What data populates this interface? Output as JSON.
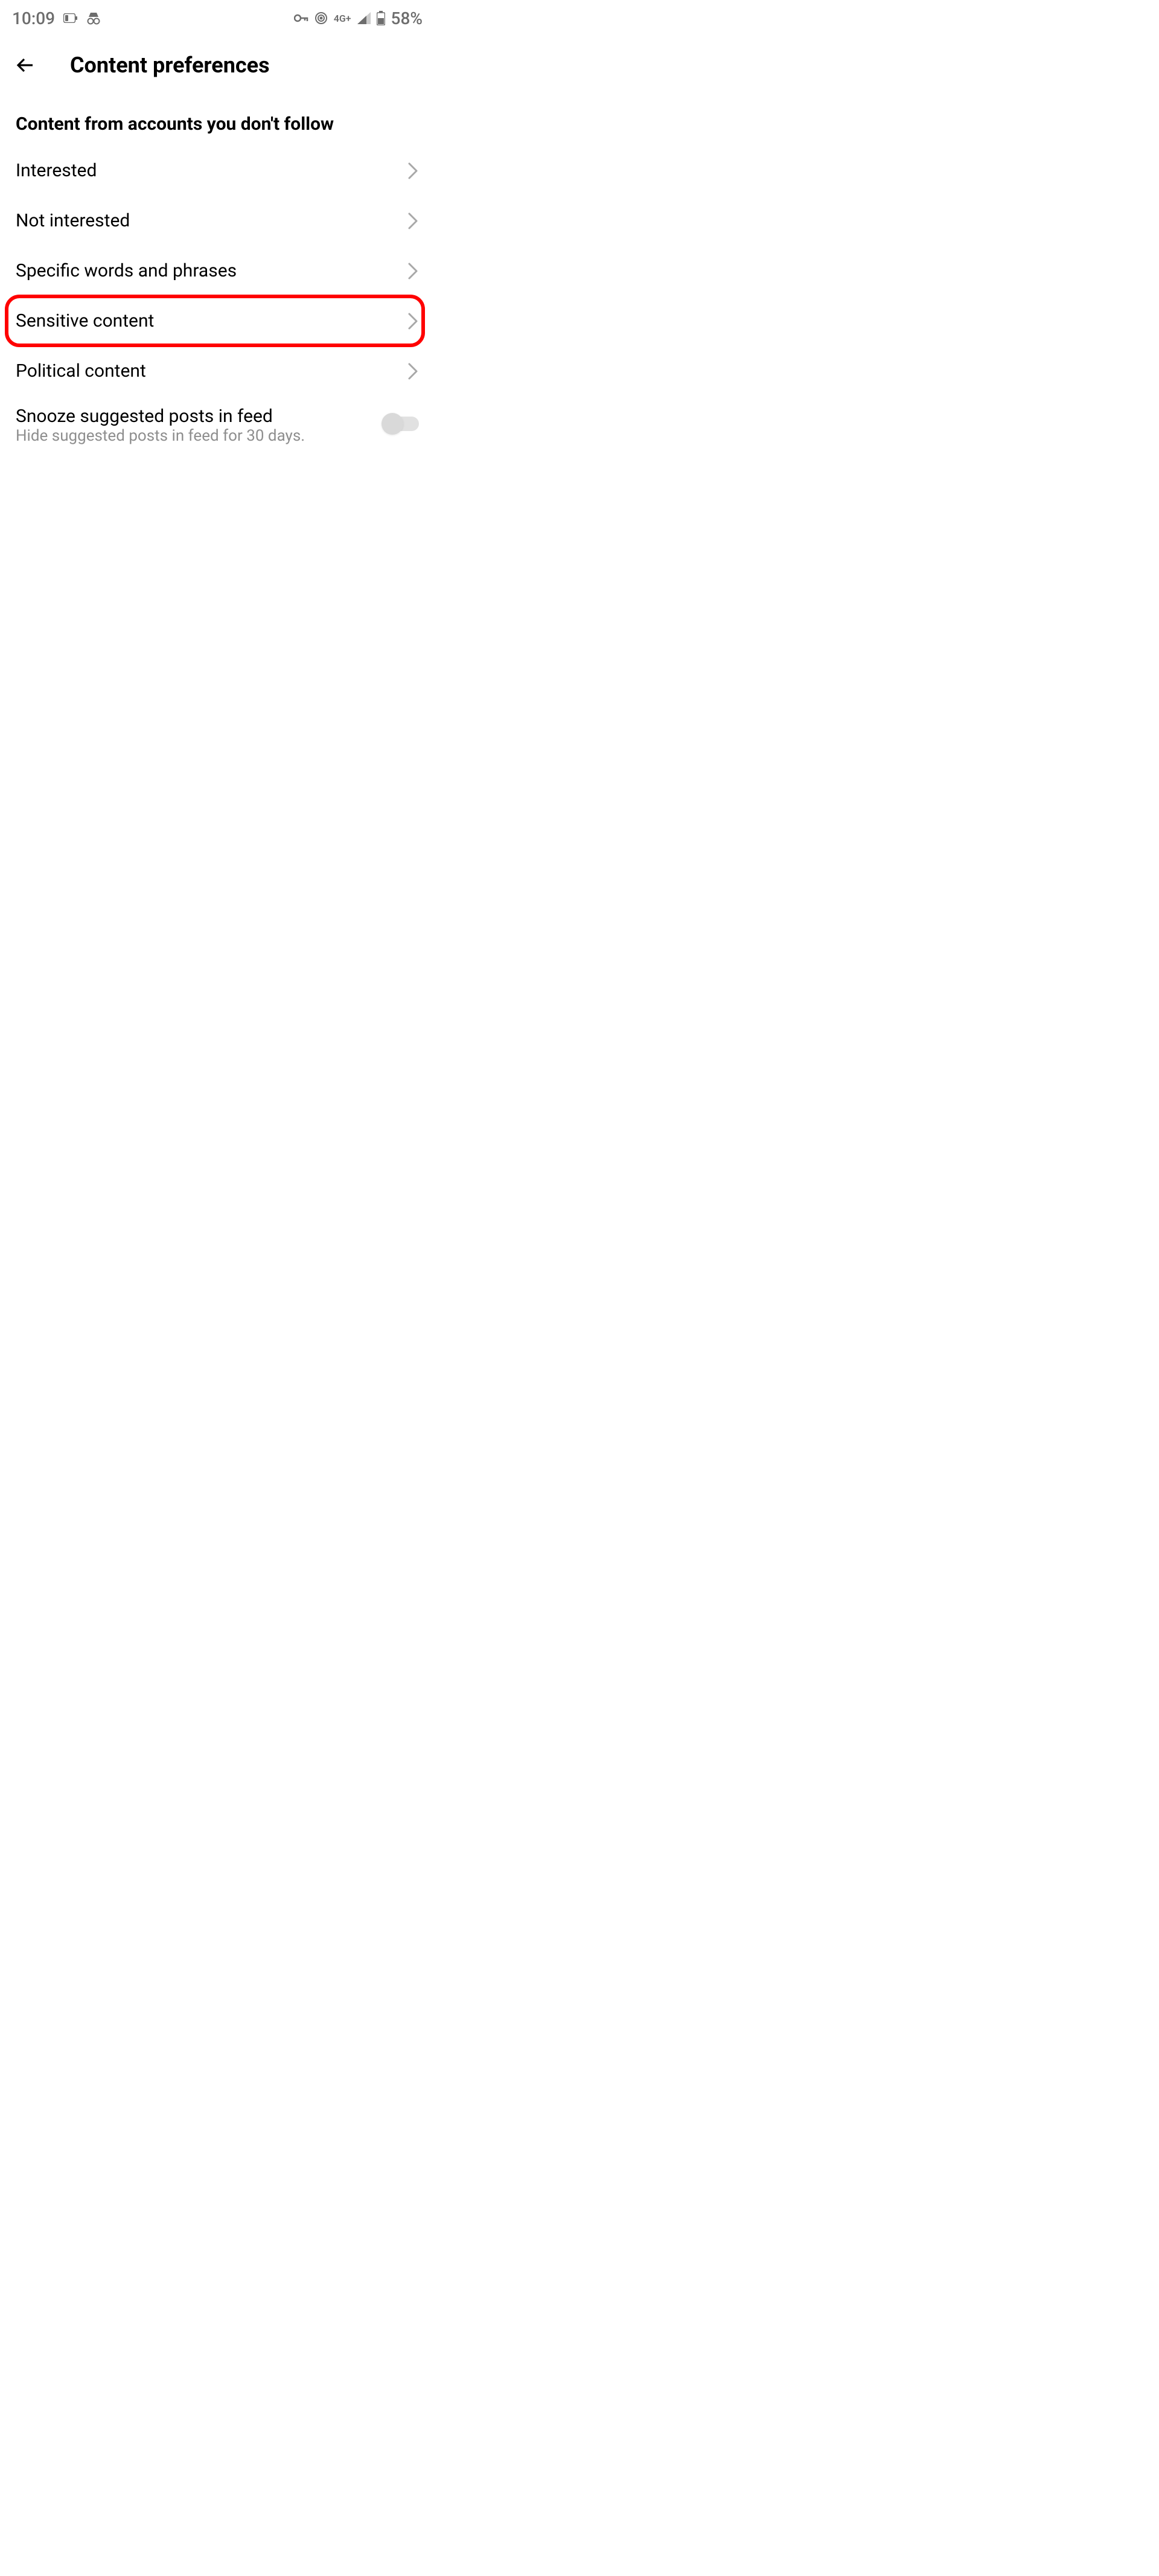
{
  "status_bar": {
    "time": "10:09",
    "network": "4G+",
    "battery": "58%"
  },
  "header": {
    "title": "Content preferences"
  },
  "section": {
    "heading": "Content from accounts you don't follow",
    "items": [
      {
        "label": "Interested",
        "highlighted": false
      },
      {
        "label": "Not interested",
        "highlighted": false
      },
      {
        "label": "Specific words and phrases",
        "highlighted": false
      },
      {
        "label": "Sensitive content",
        "highlighted": true
      },
      {
        "label": "Political content",
        "highlighted": false
      }
    ],
    "toggle": {
      "label": "Snooze suggested posts in feed",
      "description": "Hide suggested posts in feed for 30 days.",
      "enabled": false
    }
  }
}
